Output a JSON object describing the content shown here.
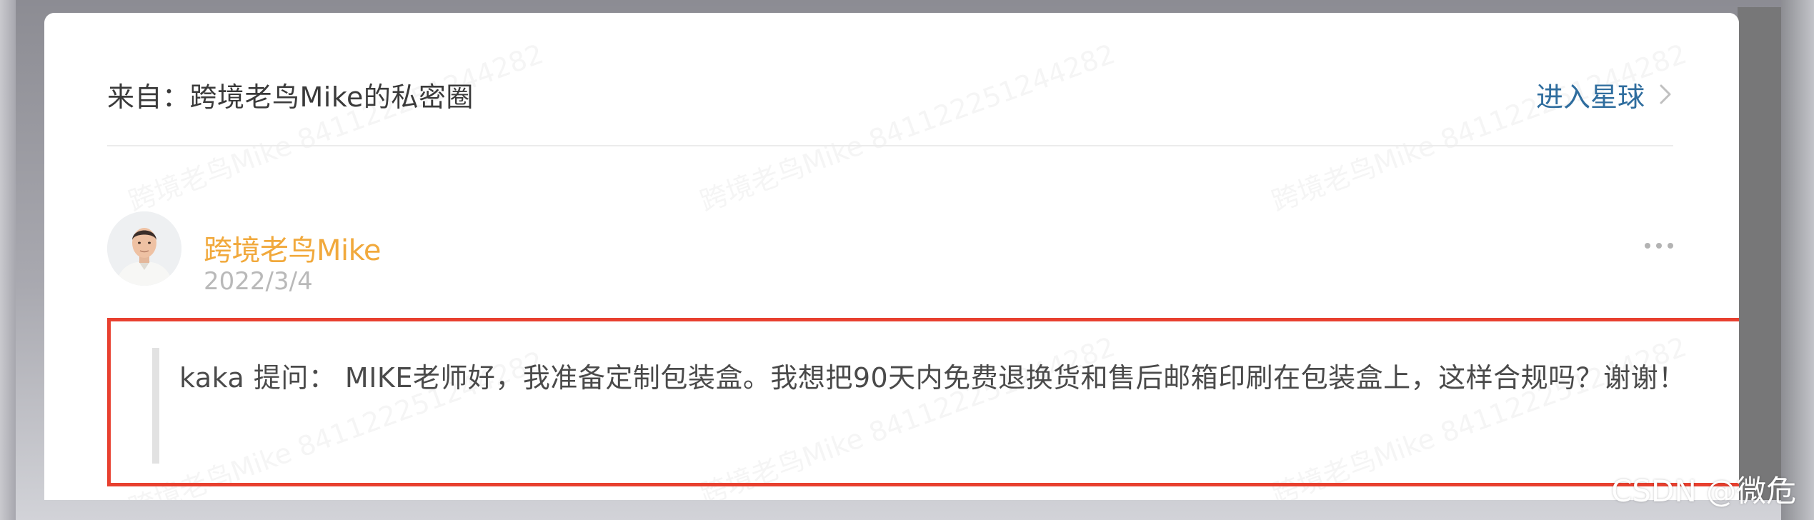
{
  "header": {
    "source": "来自：跨境老鸟Mike的私密圈",
    "enter_link": "进入星球"
  },
  "post": {
    "author_name": "跨境老鸟Mike",
    "date": "2022/3/4",
    "question": "kaka  提问：  MIKE老师好，我准备定制包装盒。我想把90天内免费退换货和售后邮箱印刷在包装盒上，这样合规吗？谢谢！"
  },
  "watermark": "跨境老鸟Mike 841122251244282",
  "site_watermark": "CSDN @微危",
  "colors": {
    "author": "#f1a93c",
    "link": "#2f6d9e",
    "highlight_border": "#e8402f"
  }
}
